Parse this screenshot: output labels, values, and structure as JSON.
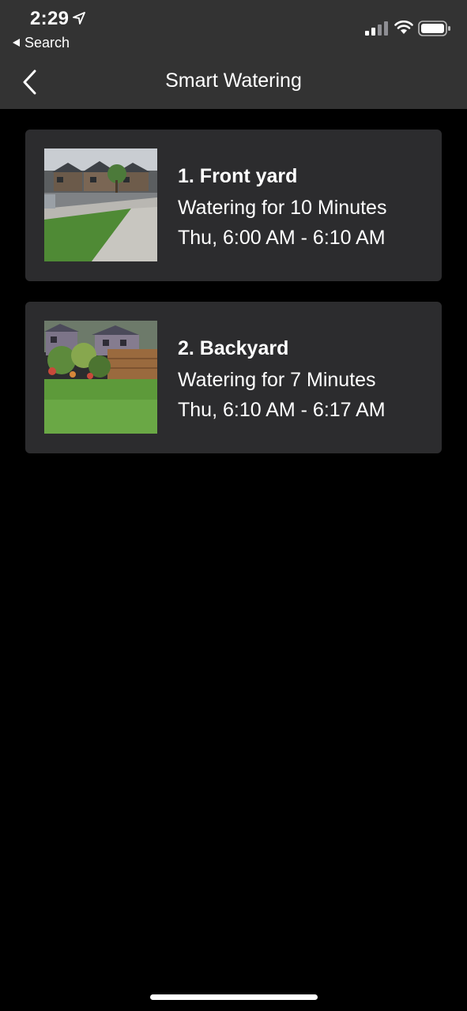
{
  "status_bar": {
    "time": "2:29",
    "back_app_label": "Search"
  },
  "nav": {
    "title": "Smart Watering"
  },
  "zones": [
    {
      "title": "1. Front yard",
      "duration": "Watering for 10 Minutes",
      "schedule": "Thu, 6:00 AM - 6:10 AM"
    },
    {
      "title": "2. Backyard",
      "duration": "Watering for 7 Minutes",
      "schedule": "Thu, 6:10 AM - 6:17 AM"
    }
  ],
  "colors": {
    "background": "#000000",
    "header": "#333333",
    "card": "#2c2c2e",
    "text": "#ffffff"
  }
}
